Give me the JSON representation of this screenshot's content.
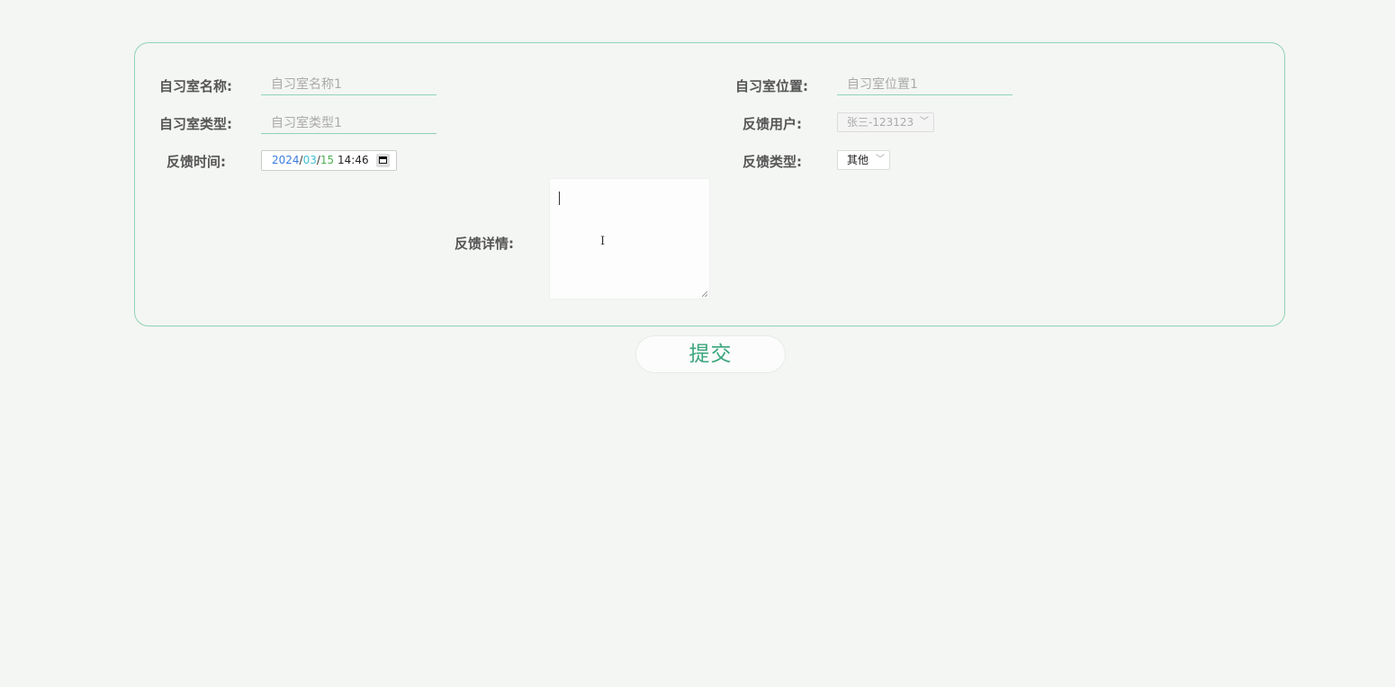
{
  "form": {
    "room_name": {
      "label": "自习室名称:",
      "placeholder": "自习室名称1"
    },
    "room_location": {
      "label": "自习室位置:",
      "placeholder": "自习室位置1"
    },
    "room_type": {
      "label": "自习室类型:",
      "placeholder": "自习室类型1"
    },
    "feedback_user": {
      "label": "反馈用户:",
      "value": "张三-123123"
    },
    "feedback_time": {
      "label": "反馈时间:",
      "year": "2024",
      "month": "03",
      "day": "15",
      "separator": "/",
      "time": "14:46"
    },
    "feedback_type": {
      "label": "反馈类型:",
      "value": "其他"
    },
    "feedback_detail": {
      "label": "反馈详情:",
      "value": ""
    }
  },
  "submit_label": "提交",
  "icons": {
    "select_chevron": "chevron-down-icon",
    "calendar": "calendar-icon",
    "text_cursor": "text-cursor-icon"
  },
  "colors": {
    "accent": "#8fd3b6",
    "button_text": "#3aa57c",
    "background": "#f4f6f3"
  }
}
